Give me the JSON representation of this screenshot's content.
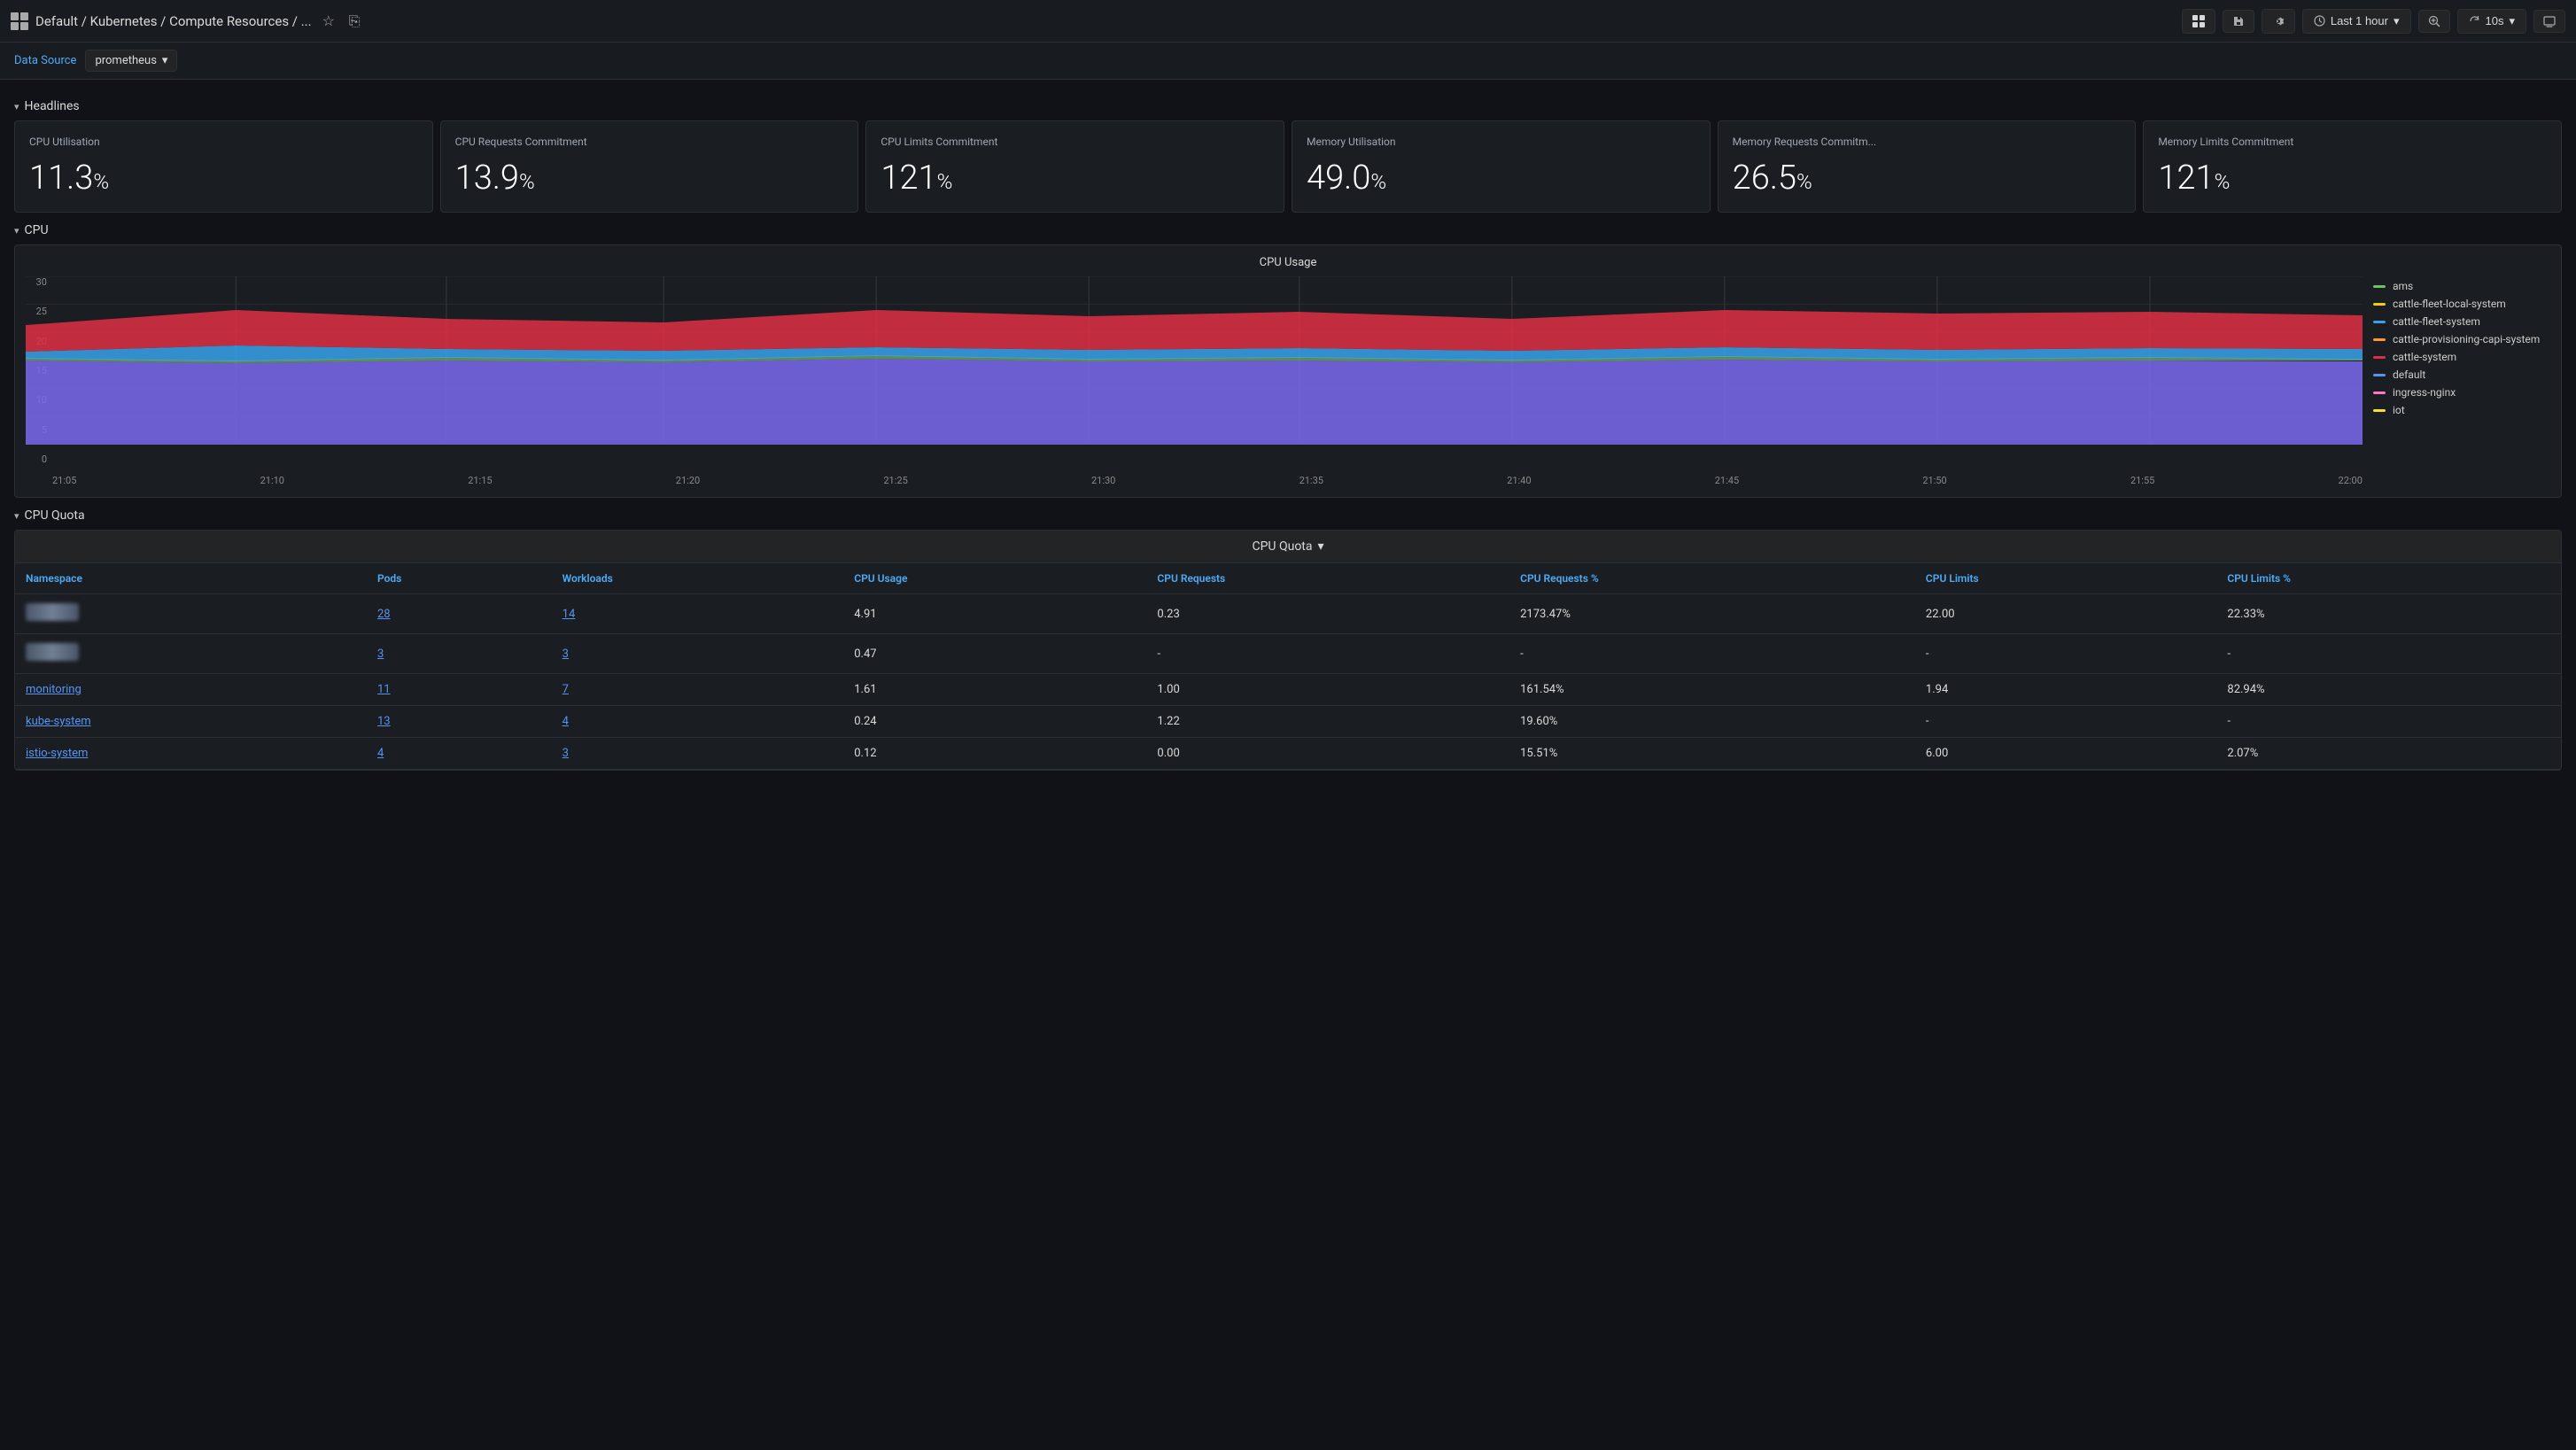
{
  "topbar": {
    "breadcrumb": "Default / Kubernetes / Compute Resources / ...",
    "star_label": "★",
    "share_label": "⎘",
    "add_panel_label": "📊",
    "save_label": "💾",
    "settings_label": "⚙",
    "time_range_label": "Last 1 hour",
    "refresh_label": "⟳",
    "interval_label": "10s",
    "tv_label": "⬜"
  },
  "datasource": {
    "label": "Data Source",
    "value": "prometheus",
    "chevron": "▾"
  },
  "headlines": {
    "section_label": "Headlines",
    "cards": [
      {
        "title": "CPU Utilisation",
        "value": "11.3",
        "unit": "%"
      },
      {
        "title": "CPU Requests Commitment",
        "value": "13.9",
        "unit": "%"
      },
      {
        "title": "CPU Limits Commitment",
        "value": "121",
        "unit": "%"
      },
      {
        "title": "Memory Utilisation",
        "value": "49.0",
        "unit": "%"
      },
      {
        "title": "Memory Requests Commitm...",
        "value": "26.5",
        "unit": "%"
      },
      {
        "title": "Memory Limits Commitment",
        "value": "121",
        "unit": "%"
      }
    ]
  },
  "cpu_section": {
    "label": "CPU",
    "chart_title": "CPU Usage",
    "y_axis": [
      "30",
      "25",
      "20",
      "15",
      "10",
      "5",
      "0"
    ],
    "x_axis": [
      "21:05",
      "21:10",
      "21:15",
      "21:20",
      "21:25",
      "21:30",
      "21:35",
      "21:40",
      "21:45",
      "21:50",
      "21:55",
      "22:00"
    ],
    "legend": [
      {
        "label": "ams",
        "color": "#73BF69"
      },
      {
        "label": "cattle-fleet-local-system",
        "color": "#F2CC0C"
      },
      {
        "label": "cattle-fleet-system",
        "color": "#37A2EB"
      },
      {
        "label": "cattle-provisioning-capi-system",
        "color": "#FF9830"
      },
      {
        "label": "cattle-system",
        "color": "#E02F44"
      },
      {
        "label": "default",
        "color": "#5794F2"
      },
      {
        "label": "ingress-nginx",
        "color": "#FF78C1"
      },
      {
        "label": "iot",
        "color": "#FADE2B"
      }
    ]
  },
  "cpu_quota_section": {
    "label": "CPU Quota",
    "table_title": "CPU Quota",
    "chevron_label": "▾",
    "columns": [
      "Namespace",
      "Pods",
      "Workloads",
      "CPU Usage",
      "CPU Requests",
      "CPU Requests %",
      "CPU Limits",
      "CPU Limits %"
    ],
    "rows": [
      {
        "namespace": "blurred",
        "pods": "28",
        "workloads": "14",
        "cpu_usage": "4.91",
        "cpu_requests": "0.23",
        "cpu_requests_pct": "2173.47%",
        "cpu_limits": "22.00",
        "cpu_limits_pct": "22.33%"
      },
      {
        "namespace": "blurred2",
        "pods": "3",
        "workloads": "3",
        "cpu_usage": "0.47",
        "cpu_requests": "-",
        "cpu_requests_pct": "-",
        "cpu_limits": "-",
        "cpu_limits_pct": "-"
      },
      {
        "namespace": "monitoring",
        "pods": "11",
        "workloads": "7",
        "cpu_usage": "1.61",
        "cpu_requests": "1.00",
        "cpu_requests_pct": "161.54%",
        "cpu_limits": "1.94",
        "cpu_limits_pct": "82.94%"
      },
      {
        "namespace": "kube-system",
        "pods": "13",
        "workloads": "4",
        "cpu_usage": "0.24",
        "cpu_requests": "1.22",
        "cpu_requests_pct": "19.60%",
        "cpu_limits": "-",
        "cpu_limits_pct": "-"
      },
      {
        "namespace": "istio-system",
        "pods": "4",
        "workloads": "3",
        "cpu_usage": "0.12",
        "cpu_requests": "0.00",
        "cpu_requests_pct": "15.51%",
        "cpu_limits": "6.00",
        "cpu_limits_pct": "2.07%"
      }
    ]
  },
  "icons": {
    "chevron_down": "▾",
    "chevron_right": "›",
    "star": "☆",
    "share": "↗",
    "clock": "🕐",
    "zoom": "🔍",
    "refresh": "↻",
    "grid": "⊞"
  }
}
